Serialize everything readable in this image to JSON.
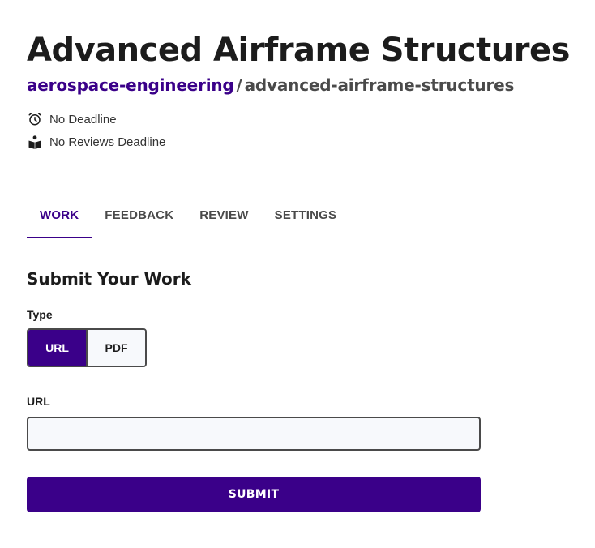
{
  "header": {
    "title": "Advanced Airframe Structures",
    "breadcrumb": {
      "org": "aerospace-engineering",
      "separator": "/",
      "repo": "advanced-airframe-structures"
    },
    "meta": {
      "deadline": {
        "icon": "alarm-clock-icon",
        "text": "No Deadline"
      },
      "reviews_deadline": {
        "icon": "book-reader-icon",
        "text": "No Reviews Deadline"
      }
    }
  },
  "tabs": [
    {
      "label": "WORK",
      "active": true
    },
    {
      "label": "FEEDBACK",
      "active": false
    },
    {
      "label": "REVIEW",
      "active": false
    },
    {
      "label": "SETTINGS",
      "active": false
    }
  ],
  "form": {
    "title": "Submit Your Work",
    "type_label": "Type",
    "type_options": [
      {
        "label": "URL",
        "selected": true
      },
      {
        "label": "PDF",
        "selected": false
      }
    ],
    "url_label": "URL",
    "url_value": "",
    "url_placeholder": "",
    "submit_label": "SUBMIT"
  },
  "colors": {
    "accent": "#3a0089",
    "text": "#1c1c1c",
    "muted": "#4a4a4a",
    "input_bg": "#f7f9fc"
  }
}
